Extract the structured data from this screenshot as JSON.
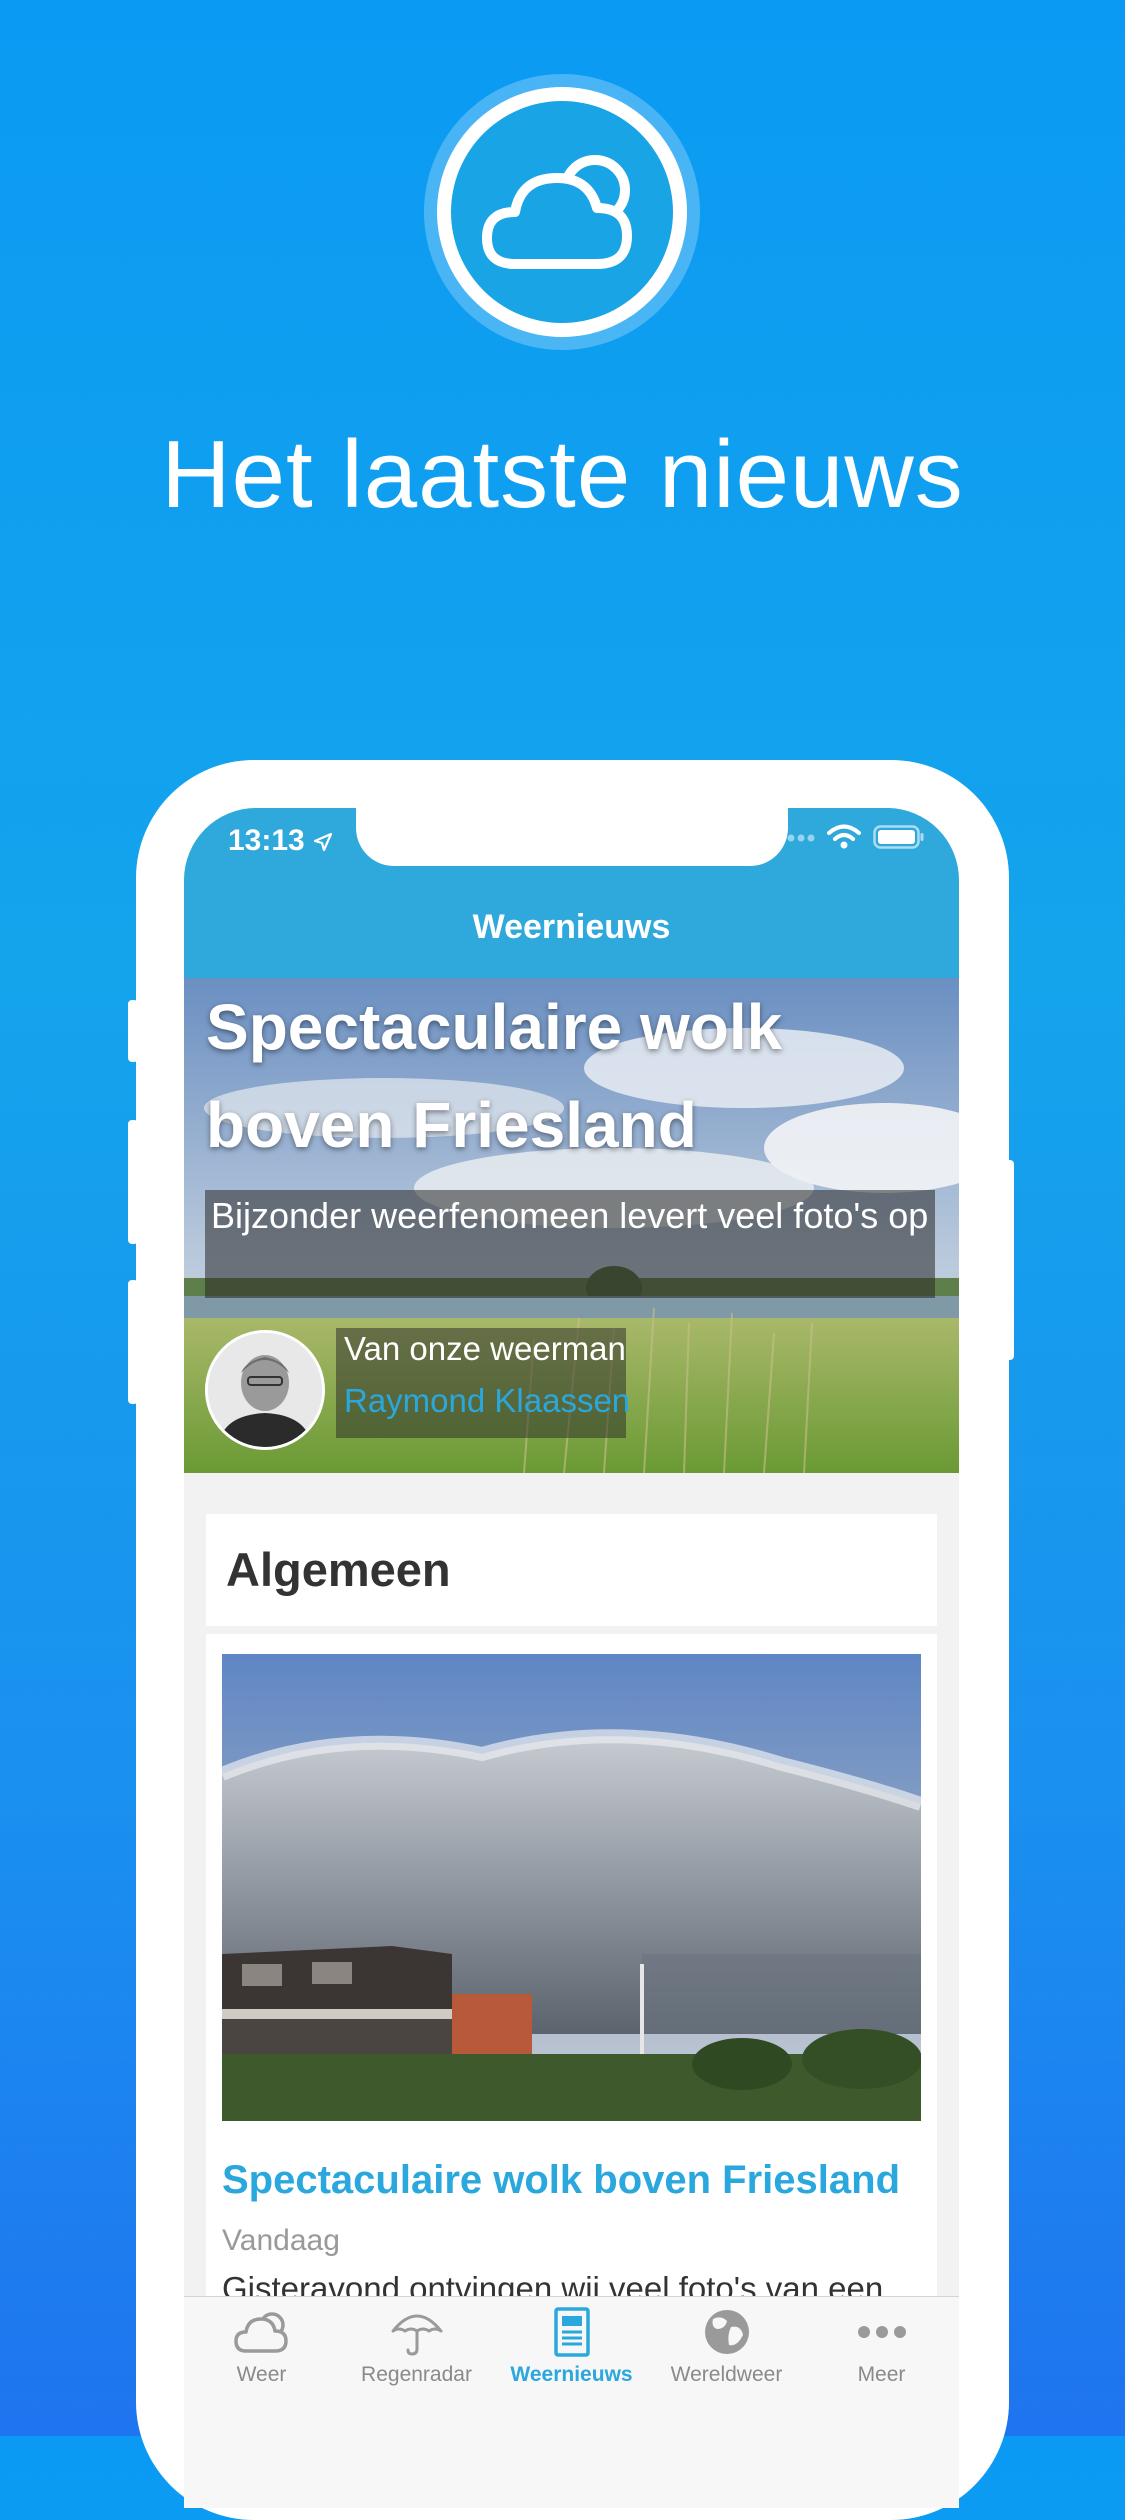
{
  "hero": {
    "headline": "Het laatste nieuws",
    "icon": "cloud-sun-icon"
  },
  "status_bar": {
    "time": "13:13",
    "icons": [
      "location-arrow-icon",
      "signal-icon",
      "wifi-icon",
      "battery-icon"
    ]
  },
  "nav": {
    "title": "Weernieuws"
  },
  "featured": {
    "title": "Spectaculaire wolk boven Friesland",
    "subtitle": "Bijzonder weerfenomeen levert veel foto's op",
    "author_intro": "Van onze weerman",
    "author_name": "Raymond Klaassen"
  },
  "section": {
    "title": "Algemeen"
  },
  "article": {
    "title": "Spectaculaire wolk boven Friesland",
    "date": "Vandaag",
    "excerpt": "Gisteravond ontvingen wij veel foto's van een"
  },
  "tabs": [
    {
      "label": "Weer",
      "icon": "cloud-icon"
    },
    {
      "label": "Regenradar",
      "icon": "umbrella-icon"
    },
    {
      "label": "Weernieuws",
      "icon": "newspaper-icon",
      "active": true
    },
    {
      "label": "Wereldweer",
      "icon": "globe-icon"
    },
    {
      "label": "Meer",
      "icon": "more-dots-icon"
    }
  ],
  "colors": {
    "accent": "#2aa7dd",
    "background_top": "#0b9af3",
    "background_bottom": "#1f74ef"
  }
}
